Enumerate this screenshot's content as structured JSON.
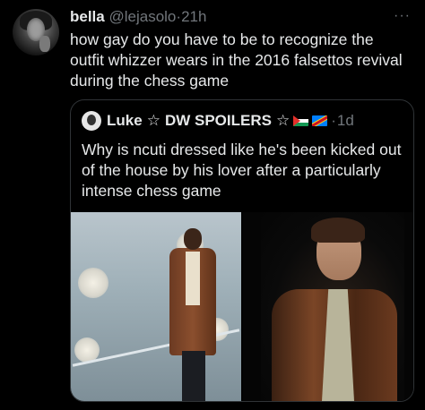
{
  "tweet": {
    "author_name": "bella",
    "handle": "@lejasolo",
    "separator": "·",
    "time": "21h",
    "more": "···",
    "text": "how gay do you have to be to recognize the outfit whizzer wears in the 2016 falsettos revival during the chess game"
  },
  "quoted": {
    "author_name": "Luke",
    "star1": "☆",
    "suffix": "DW SPOILERS",
    "star2": "☆",
    "separator": "·",
    "time": "1d",
    "text": "Why is ncuti dressed like he's been kicked out of the house by his lover after a particularly intense chess game",
    "flags": [
      "palestine-flag",
      "congo-flag"
    ]
  },
  "colors": {
    "background": "#000000",
    "text": "#e7e9ea",
    "muted": "#71767b",
    "border": "#2f3336"
  }
}
